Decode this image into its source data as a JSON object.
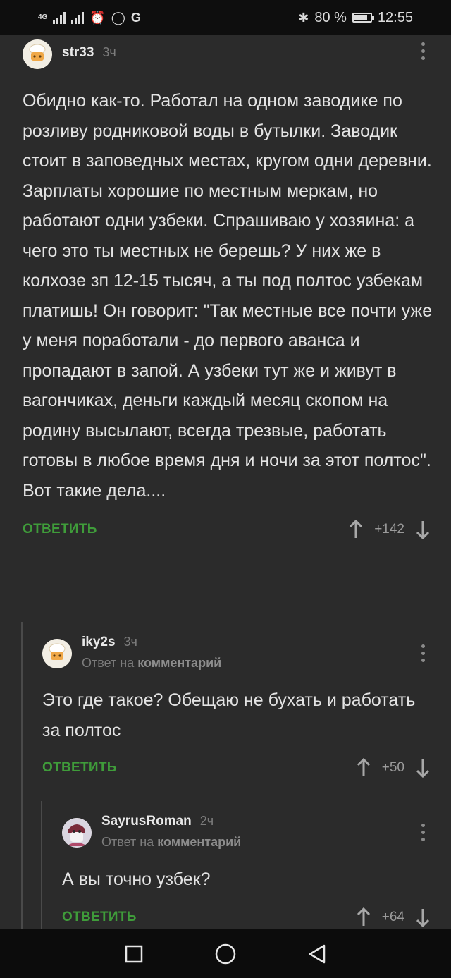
{
  "status_bar": {
    "network": "4G",
    "battery_percent": "80 %",
    "battery_level": 0.8,
    "time": "12:55",
    "g_label": "G"
  },
  "comments": [
    {
      "author": "str33",
      "time": "3ч",
      "reply_prefix": "",
      "reply_target": "",
      "text": "Обидно как-то. Работал на одном заводике по розливу родниковой воды в бутылки. Заводик стоит в заповедных местах, кругом одни деревни. Зарплаты хорошие по местным меркам, но работают одни узбеки. Спрашиваю у хозяина: а чего это ты местных не берешь? У них же в колхозе зп 12-15 тысяч, а ты под полтос узбекам платишь!  Он говорит: \"Так местные все почти уже у меня поработали - до первого аванса и пропадают в запой. А узбеки тут же и живут в вагончиках, деньги каждый месяц скопом на родину высылают, всегда трезвые, работать готовы в любое время дня и ночи за этот полтос\". Вот такие дела....",
      "reply_label": "ОТВЕТИТЬ",
      "score": "+142",
      "avatar": "chef-hat-avatar"
    },
    {
      "author": "iky2s",
      "time": "3ч",
      "reply_prefix": "Ответ на",
      "reply_target": "комментарий",
      "text": "Это где такое? Обещаю не бухать и работать за полтос",
      "reply_label": "ОТВЕТИТЬ",
      "score": "+50",
      "avatar": "chef-hat-avatar"
    },
    {
      "author": "SayrusRoman",
      "time": "2ч",
      "reply_prefix": "Ответ на",
      "reply_target": "комментарий",
      "text": "А вы точно узбек?",
      "reply_label": "ОТВЕТИТЬ",
      "score": "+64",
      "avatar": "masked-person-avatar"
    }
  ],
  "colors": {
    "background": "#2b2b2b",
    "accent_green": "#3f9c3a",
    "muted": "#7c7c7c"
  }
}
